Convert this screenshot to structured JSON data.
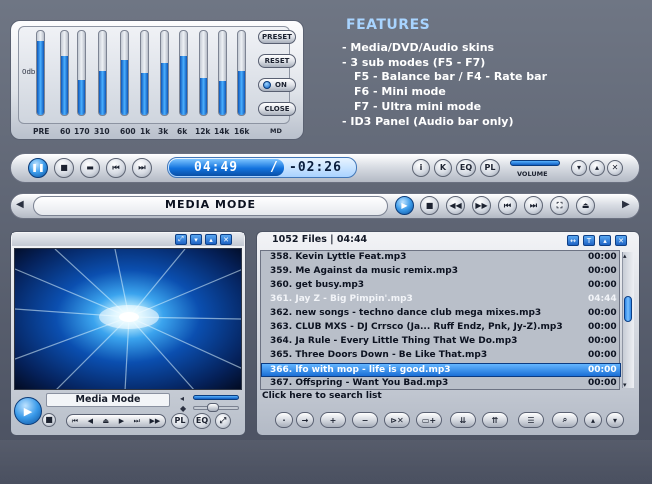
{
  "equalizer": {
    "zero_db_label": "0db",
    "bands": [
      {
        "label": "PRE",
        "level": 0.88
      },
      {
        "label": "60",
        "level": 0.7
      },
      {
        "label": "170",
        "level": 0.42
      },
      {
        "label": "310",
        "level": 0.52
      },
      {
        "label": "600",
        "level": 0.65
      },
      {
        "label": "1k",
        "level": 0.5
      },
      {
        "label": "3k",
        "level": 0.62
      },
      {
        "label": "6k",
        "level": 0.7
      },
      {
        "label": "12k",
        "level": 0.44
      },
      {
        "label": "14k",
        "level": 0.4
      },
      {
        "label": "16k",
        "level": 0.52
      }
    ],
    "band_labels_text": [
      "PRE",
      "60",
      "170",
      "310",
      "600",
      "1k",
      "3k",
      "6k",
      "12k",
      "14k",
      "16k"
    ],
    "md_label": "MD",
    "buttons": {
      "preset": "PRESET",
      "reset": "RESET",
      "on": "ON",
      "close": "CLOSE"
    }
  },
  "features": {
    "title": "FEATURES",
    "lines": [
      "- Media/DVD/Audio skins",
      "- 3 sub modes (F5 - F7)",
      "   F5 - Balance bar / F4 - Rate bar",
      "   F6 - Mini mode",
      "   F7 - Ultra mini mode",
      "- ID3 Panel (Audio bar only)"
    ]
  },
  "transport": {
    "elapsed": "04:49",
    "separator": "/",
    "remaining": "-02:26",
    "volume_label": "VOLUME",
    "volume_level": 0.9,
    "small_buttons": [
      "i",
      "K",
      "EQ",
      "PL"
    ]
  },
  "mediabar": {
    "mode_label": "MEDIA MODE"
  },
  "video": {
    "name": "Media Mode",
    "buttons": [
      "PL",
      "EQ"
    ]
  },
  "playlist": {
    "header": "1052 Files | 04:44",
    "rows": [
      {
        "title": "358. Kevin Lyttle Feat.mp3",
        "time": "00:00",
        "state": ""
      },
      {
        "title": "359. Me Against da music remix.mp3",
        "time": "00:00",
        "state": ""
      },
      {
        "title": "360. get busy.mp3",
        "time": "00:00",
        "state": ""
      },
      {
        "title": "361. Jay Z - Big Pimpin'.mp3",
        "time": "04:44",
        "state": "playing"
      },
      {
        "title": "362. new songs - techno dance club mega mixes.mp3",
        "time": "00:00",
        "state": ""
      },
      {
        "title": "363. CLUB MXS - DJ Crrsco (Ja... Ruff Endz, Pnk, Jy-Z).mp3",
        "time": "00:00",
        "state": ""
      },
      {
        "title": "364. Ja Rule - Every Little Thing That We Do.mp3",
        "time": "00:00",
        "state": ""
      },
      {
        "title": "365. Three Doors Down - Be Like That.mp3",
        "time": "00:00",
        "state": ""
      },
      {
        "title": "366. lfo with mop - life is good.mp3",
        "time": "00:00",
        "state": "selected"
      },
      {
        "title": "367. Offspring - Want You Bad.mp3",
        "time": "00:00",
        "state": ""
      }
    ],
    "search_hint": "Click here to search list"
  }
}
